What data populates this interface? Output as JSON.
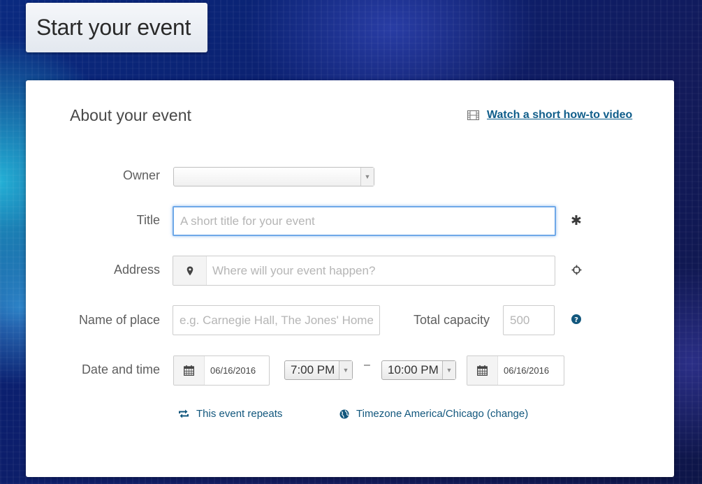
{
  "header": {
    "title": "Start your event"
  },
  "form": {
    "section_title": "About your event",
    "howto_link": "Watch a short how-to video",
    "owner": {
      "label": "Owner",
      "value": ""
    },
    "title": {
      "label": "Title",
      "placeholder": "A short title for your event",
      "required_mark": "✱"
    },
    "address": {
      "label": "Address",
      "placeholder": "Where will your event happen?"
    },
    "place": {
      "label": "Name of place",
      "placeholder": "e.g. Carnegie Hall, The Jones' Home"
    },
    "capacity": {
      "label": "Total capacity",
      "placeholder": "500"
    },
    "datetime": {
      "label": "Date and time",
      "start_date": "06/16/2016",
      "start_time": "7:00 PM",
      "separator": "–",
      "end_time": "10:00 PM",
      "end_date": "06/16/2016"
    },
    "repeats_link": "This event repeats",
    "timezone_link": "Timezone America/Chicago (change)"
  },
  "colors": {
    "link": "#0f5d8a",
    "focus_border": "#6ea8e8",
    "icon": "#12577d"
  }
}
